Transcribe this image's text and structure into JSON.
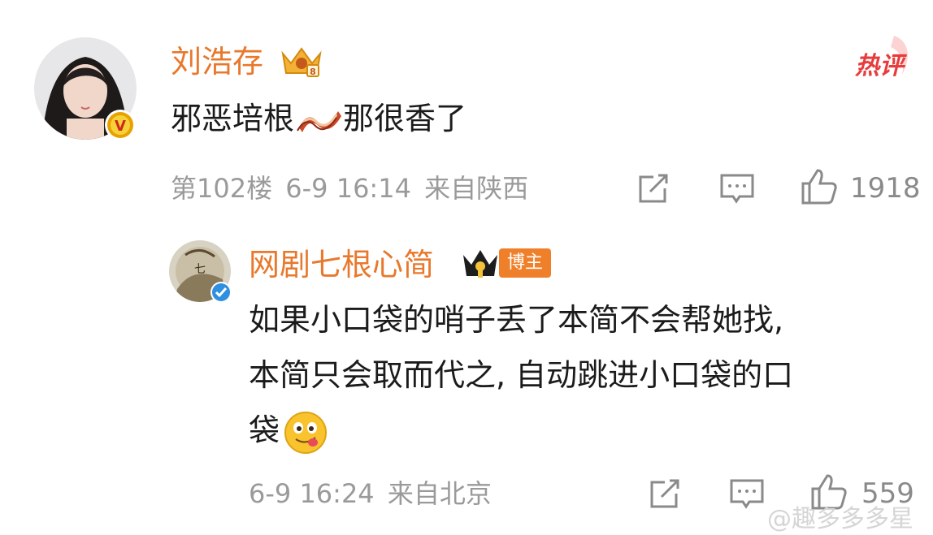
{
  "comment": {
    "author": "刘浩存",
    "hot_label": "热评",
    "text_before": "邪恶培根",
    "text_after": "那很香了",
    "floor": "第102楼",
    "time": "6-9 16:14",
    "location": "来自陕西",
    "like_count": "1918",
    "verified_color": "#e8a100"
  },
  "reply": {
    "author": "网剧七根心简",
    "host_badge": "博主",
    "text_line1": "如果小口袋的哨子丢了本简不会帮她找,",
    "text_line2": "本简只会取而代之, 自动跳进小口袋的口",
    "text_line3": "袋",
    "time": "6-9 16:24",
    "location": "来自北京",
    "like_count": "559",
    "verified_color": "#2f8fe0"
  },
  "watermark": "@趣多多多星",
  "colors": {
    "name": "#e8782b",
    "meta": "#9a9a9a",
    "hot": "#e83b3b"
  },
  "icons": [
    "crown-badge-icon",
    "bacon-emoji-icon",
    "share-icon",
    "comment-icon",
    "like-icon",
    "tongue-out-emoji-icon",
    "verified-icon"
  ]
}
